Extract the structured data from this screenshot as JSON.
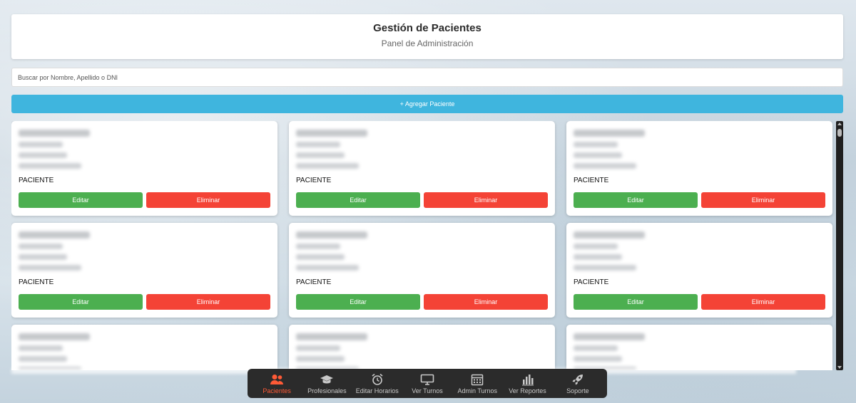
{
  "header": {
    "title": "Gestión de Pacientes",
    "subtitle": "Panel de Administración"
  },
  "search": {
    "placeholder": "Buscar por Nombre, Apellido o DNI",
    "value": ""
  },
  "actions": {
    "add_label": "+ Agregar Paciente"
  },
  "cards": [
    {
      "role": "PACIENTE",
      "edit_label": "Editar",
      "delete_label": "Eliminar"
    },
    {
      "role": "PACIENTE",
      "edit_label": "Editar",
      "delete_label": "Eliminar"
    },
    {
      "role": "PACIENTE",
      "edit_label": "Editar",
      "delete_label": "Eliminar"
    },
    {
      "role": "PACIENTE",
      "edit_label": "Editar",
      "delete_label": "Eliminar"
    },
    {
      "role": "PACIENTE",
      "edit_label": "Editar",
      "delete_label": "Eliminar"
    },
    {
      "role": "PACIENTE",
      "edit_label": "Editar",
      "delete_label": "Eliminar"
    },
    {
      "role": "",
      "edit_label": "",
      "delete_label": ""
    },
    {
      "role": "",
      "edit_label": "",
      "delete_label": ""
    },
    {
      "role": "",
      "edit_label": "",
      "delete_label": ""
    }
  ],
  "nav": {
    "items": [
      {
        "label": "Pacientes",
        "icon": "users-icon",
        "active": true
      },
      {
        "label": "Profesionales",
        "icon": "graduation-cap-icon",
        "active": false
      },
      {
        "label": "Editar Horarios",
        "icon": "alarm-clock-icon",
        "active": false
      },
      {
        "label": "Ver Turnos",
        "icon": "monitor-icon",
        "active": false
      },
      {
        "label": "Admin Turnos",
        "icon": "calendar-icon",
        "active": false
      },
      {
        "label": "Ver Reportes",
        "icon": "bar-chart-icon",
        "active": false
      },
      {
        "label": "Soporte",
        "icon": "rocket-icon",
        "active": false
      }
    ]
  },
  "colors": {
    "accent_blue": "#3fb5de",
    "edit_green": "#4caf50",
    "delete_red": "#f44336",
    "nav_active": "#ff5a36",
    "nav_bg": "#2b2b2b"
  }
}
